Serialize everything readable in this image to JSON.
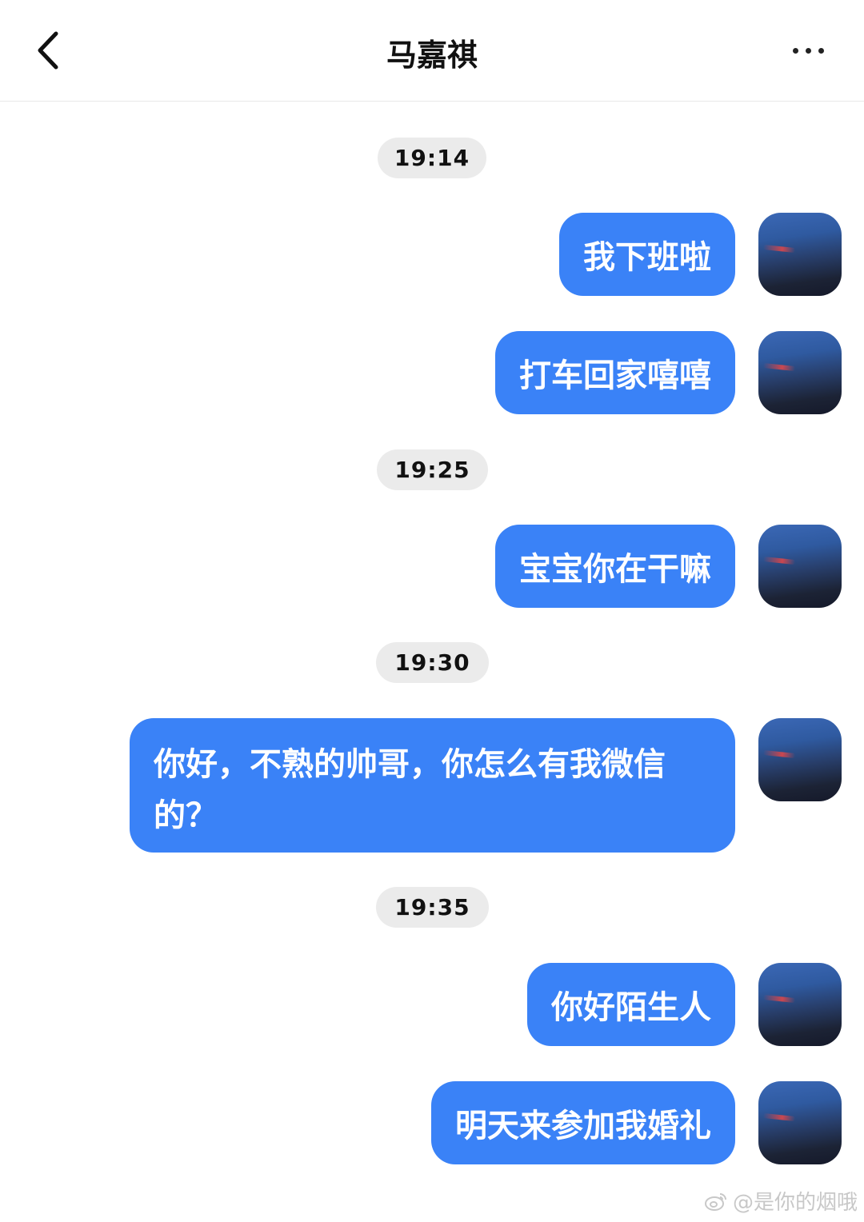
{
  "header": {
    "title": "马嘉祺",
    "back_icon": "chevron-left-icon",
    "more_icon": "more-horizontal-icon"
  },
  "messages": [
    {
      "time": "19:14"
    },
    {
      "text": "我下班啦"
    },
    {
      "text": "打车回家嘻嘻"
    },
    {
      "time": "19:25"
    },
    {
      "text": "宝宝你在干嘛"
    },
    {
      "time": "19:30"
    },
    {
      "text": "你好，不熟的帅哥，你怎么有我微信的？"
    },
    {
      "time": "19:35"
    },
    {
      "text": "你好陌生人"
    },
    {
      "text": "明天来参加我婚礼"
    }
  ],
  "watermark": {
    "text": "@是你的烟哦",
    "icon": "weibo-logo-icon"
  },
  "colors": {
    "bubble": "#3a82f7",
    "time_pill": "#ebebeb"
  }
}
